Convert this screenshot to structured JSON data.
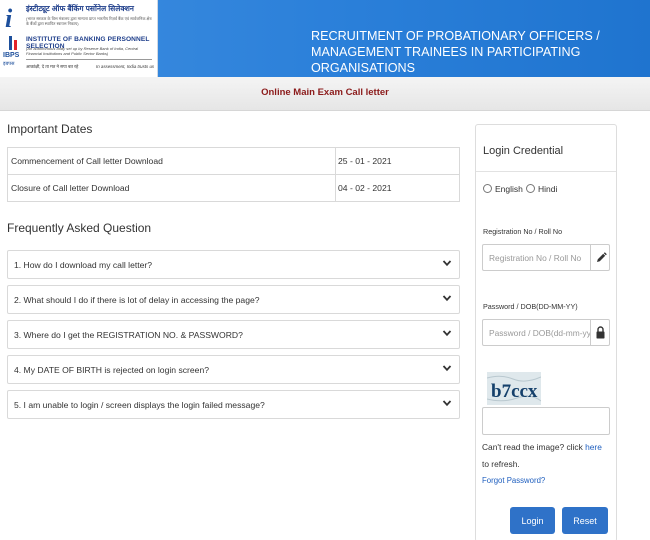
{
  "header": {
    "logo": {
      "org_name_hindi": "इंस्टीट्यूट ऑफ बैंकिंग पर्सोनेल सिलेक्शन",
      "org_hindi_subtitle": "(भारत सरकार के वित्त मंत्रालय द्वारा मान्यता प्राप्त भारतीय रिज़र्व बैंक एवं सार्वजनिक क्षेत्र के बैंकों द्वारा स्थापित स्वायत्त निकाय)",
      "org_name": "INSTITUTE OF BANKING PERSONNEL SELECTION",
      "org_description": "(An autonomous body set up by Reserve Bank of India, Central Financial Institutions and Public Sector Banks)",
      "motto_hindi": "आकांक्षी, दे ता मत ने सपा बत रहे",
      "motto_english": "In assessment, India trusts us",
      "acronym": "IBPS",
      "acronym_sub": "इबपस"
    },
    "title_line1": "RECRUITMENT OF PROBATIONARY OFFICERS /",
    "title_line2": "MANAGEMENT TRAINEES IN PARTICIPATING ORGANISATIONS"
  },
  "subheader": {
    "title": "Online Main Exam Call letter"
  },
  "important_dates": {
    "heading": "Important Dates",
    "rows": [
      {
        "label": "Commencement of Call letter Download",
        "value": "25 - 01 - 2021"
      },
      {
        "label": "Closure of Call letter Download",
        "value": "04 - 02 - 2021"
      }
    ]
  },
  "faq": {
    "heading": "Frequently Asked Question",
    "items": [
      "1. How do I download my call letter?",
      "2. What should I do if there is lot of delay in accessing the page?",
      "3. Where do I get the REGISTRATION NO. & PASSWORD?",
      "4. My DATE OF BIRTH is rejected on login screen?",
      "5. I am unable to login / screen displays the login failed message?"
    ]
  },
  "login": {
    "title": "Login Credential",
    "language_options": [
      "English",
      "Hindi"
    ],
    "registration_label": "Registration No / Roll No",
    "registration_placeholder": "Registration No / Roll No",
    "registration_value": "",
    "password_label": "Password / DOB(DD-MM-YY)",
    "password_placeholder": "Password / DOB(dd-mm-yy)",
    "password_value": "",
    "captcha_text": "b7ccx",
    "captcha_value": "",
    "captcha_note_before": "Can't read the image? click ",
    "captcha_note_link": "here",
    "captcha_note_after": " to refresh.",
    "forgot_password": "Forgot Password?",
    "login_button": "Login",
    "reset_button": "Reset"
  },
  "colors": {
    "header_blue": "#2a7fd9",
    "subheader_text": "#8b1a1a",
    "button_blue": "#2f72c8",
    "link_blue": "#1f5fbf"
  },
  "icons": {
    "faq_toggle": "chevron-down-icon",
    "registration_addon": "pencil-icon",
    "password_addon": "lock-icon"
  }
}
